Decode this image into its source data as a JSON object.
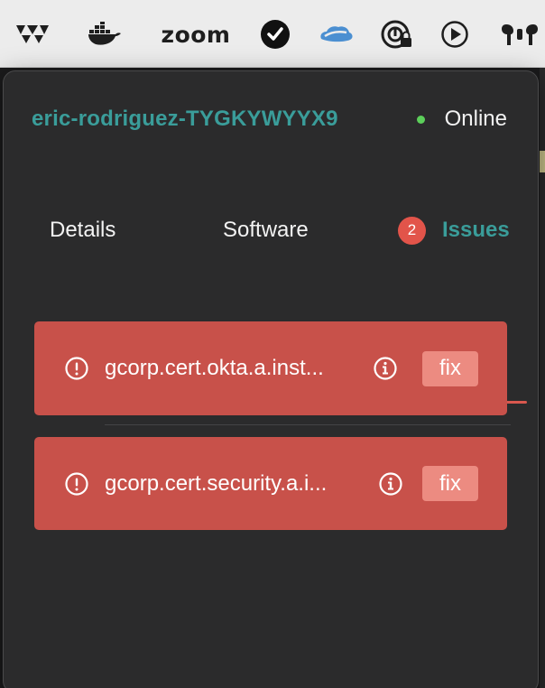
{
  "menubar": {
    "icons": [
      "wavelike-app-icon",
      "docker-icon",
      "zoom-icon",
      "checkmark-app-icon",
      "cloud-app-icon",
      "password-lock-icon",
      "play-icon",
      "airpods-icon"
    ],
    "zoom_label": "zoom"
  },
  "device": {
    "hostname": "eric-rodriguez-TYGKYWYYX9",
    "status": "Online",
    "status_color": "#5ccf5a"
  },
  "tabs": [
    {
      "label": "Details",
      "active": false
    },
    {
      "label": "Software",
      "active": false
    },
    {
      "label": "Issues",
      "active": true,
      "badge": "2"
    }
  ],
  "issues": [
    {
      "name": "gcorp.cert.okta.a.inst...",
      "action": "fix"
    },
    {
      "name": "gcorp.cert.security.a.i...",
      "action": "fix"
    }
  ],
  "colors": {
    "accent": "#3a9d9a",
    "issue_bg": "#c8514a",
    "fix_bg": "#ec8b81",
    "badge": "#e2544a"
  }
}
